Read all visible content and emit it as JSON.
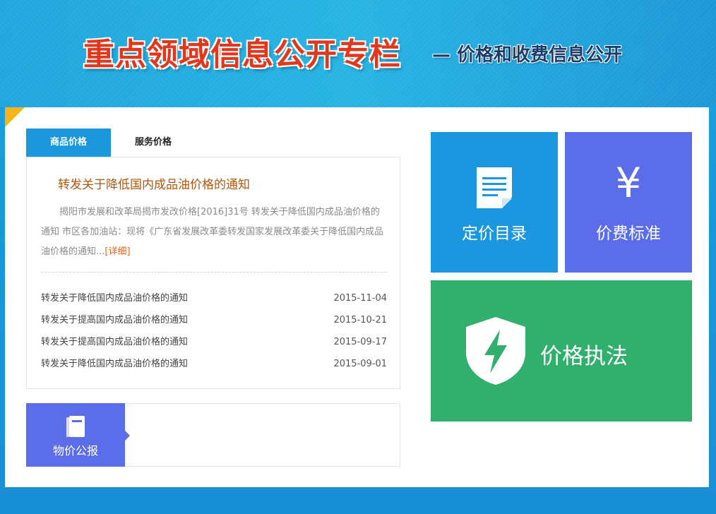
{
  "banner": {
    "title": "重点领域信息公开专栏",
    "subtitle": "— 价格和收费信息公开"
  },
  "tabs": [
    {
      "label": "商品价格",
      "active": true
    },
    {
      "label": "服务价格",
      "active": false
    }
  ],
  "featured": {
    "title": "转发关于降低国内成品油价格的通知",
    "summary": "揭阳市发展和改革局揭市发改价格[2016]31号 转发关于降低国内成品油价格的通知 市区各加油站：现将《广东省发展改革委转发国家发展改革委关于降低国内成品油价格的通知...",
    "more_label": "[详细]"
  },
  "news": [
    {
      "title": "转发关于降低国内成品油价格的通知",
      "date": "2015-11-04"
    },
    {
      "title": "转发关于提高国内成品油价格的通知",
      "date": "2015-10-21"
    },
    {
      "title": "转发关于提高国内成品油价格的通知",
      "date": "2015-09-17"
    },
    {
      "title": "转发关于降低国内成品油价格的通知",
      "date": "2015-09-01"
    }
  ],
  "bulletin": {
    "label": "物价公报",
    "icon": "book-icon"
  },
  "tiles": {
    "pricing": {
      "label": "定价目录",
      "icon": "document-icon",
      "color": "#1b97e0"
    },
    "fees": {
      "label": "价费标准",
      "icon": "yen-icon",
      "glyph": "¥",
      "color": "#5b6de8"
    },
    "law": {
      "label": "价格执法",
      "icon": "shield-lightning-icon",
      "color": "#30b06c"
    }
  },
  "colors": {
    "accent_blue": "#1b97db",
    "accent_orange": "#e8621a",
    "corner_yellow": "#f8b51a"
  }
}
